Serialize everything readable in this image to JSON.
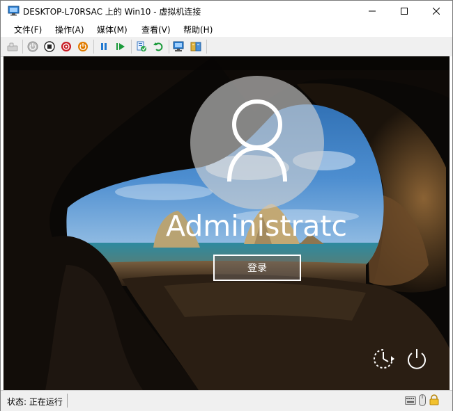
{
  "window": {
    "title": "DESKTOP-L70RSAC 上的 Win10 - 虚拟机连接"
  },
  "menu": {
    "items": [
      {
        "label": "文件(F)"
      },
      {
        "label": "操作(A)"
      },
      {
        "label": "媒体(M)"
      },
      {
        "label": "查看(V)"
      },
      {
        "label": "帮助(H)"
      }
    ]
  },
  "toolbar": {
    "icons": [
      "ctrl-alt-del-icon",
      "start-icon",
      "turn-off-icon",
      "shut-down-icon",
      "save-icon",
      "pause-icon",
      "resume-icon",
      "checkpoint-icon",
      "revert-icon",
      "enhanced-session-icon",
      "share-icon"
    ]
  },
  "login": {
    "username": "Administratc",
    "signin_label": "登录"
  },
  "status": {
    "text": "状态: 正在运行"
  },
  "colors": {
    "pause": "#1f78d1",
    "resume": "#1a9a3a",
    "turn_off": "#c81d25",
    "shut_down": "#e07b00"
  }
}
